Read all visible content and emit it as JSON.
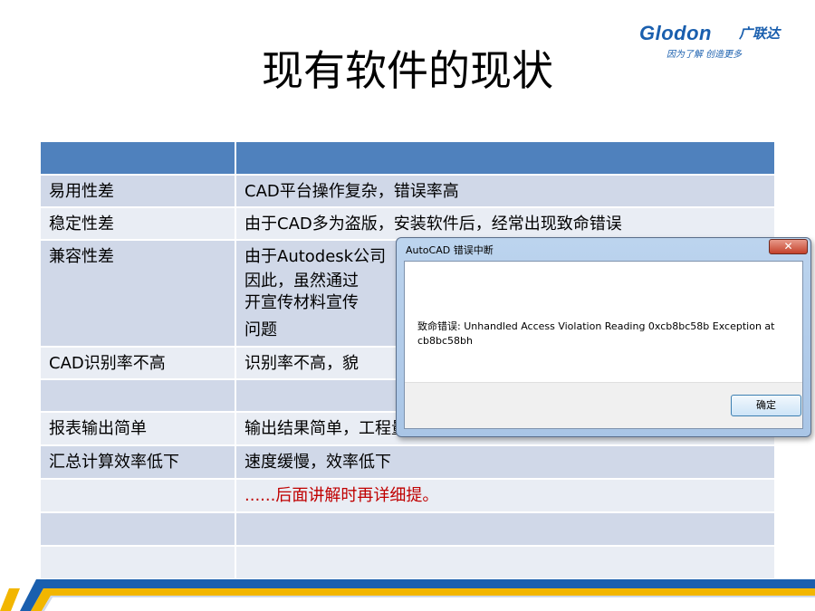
{
  "logo": {
    "brand": "Glodon",
    "brand_cn": "广联达",
    "slogan": "因为了解  创造更多"
  },
  "slide": {
    "title": "现有软件的现状"
  },
  "table": {
    "rows": [
      {
        "c1": "",
        "c2": "",
        "c2_extra": []
      },
      {
        "c1": "易用性差",
        "c2": "CAD平台操作复杂，错误率高"
      },
      {
        "c1": "稳定性差",
        "c2": "由于CAD多为盗版，安装软件后，经常出现致命错误"
      },
      {
        "c1": "兼容性差",
        "c2_lines": [
          "由于Autodesk公司",
          "因此，虽然通过",
          "开宣传材料宣传",
          "问题"
        ]
      },
      {
        "c1": "CAD识别率不高",
        "c2": "识别率不高，貌"
      },
      {
        "c1": "",
        "c2": ""
      },
      {
        "c1": "报表输出简单",
        "c2": "输出结果简单，工程量分类输出不清晰"
      },
      {
        "c1": "汇总计算效率低下",
        "c2": "速度缓慢，效率低下"
      },
      {
        "c1": "",
        "c2": "......后面讲解时再详细提。"
      },
      {
        "c1": "",
        "c2": ""
      },
      {
        "c1": "",
        "c2": ""
      }
    ]
  },
  "dialog": {
    "title": "AutoCAD 错误中断",
    "close_glyph": "✕",
    "message": "致命错误: Unhandled Access Violation Reading 0xcb8bc58b Exception at cb8bc58bh",
    "ok_label": "确定"
  },
  "colors": {
    "header_blue": "#4f81bd",
    "row_odd": "#d0d8e8",
    "row_even": "#e9edf4",
    "note_red": "#c00000",
    "brand_blue": "#1a5fae",
    "stripe_yellow": "#f2b600"
  }
}
